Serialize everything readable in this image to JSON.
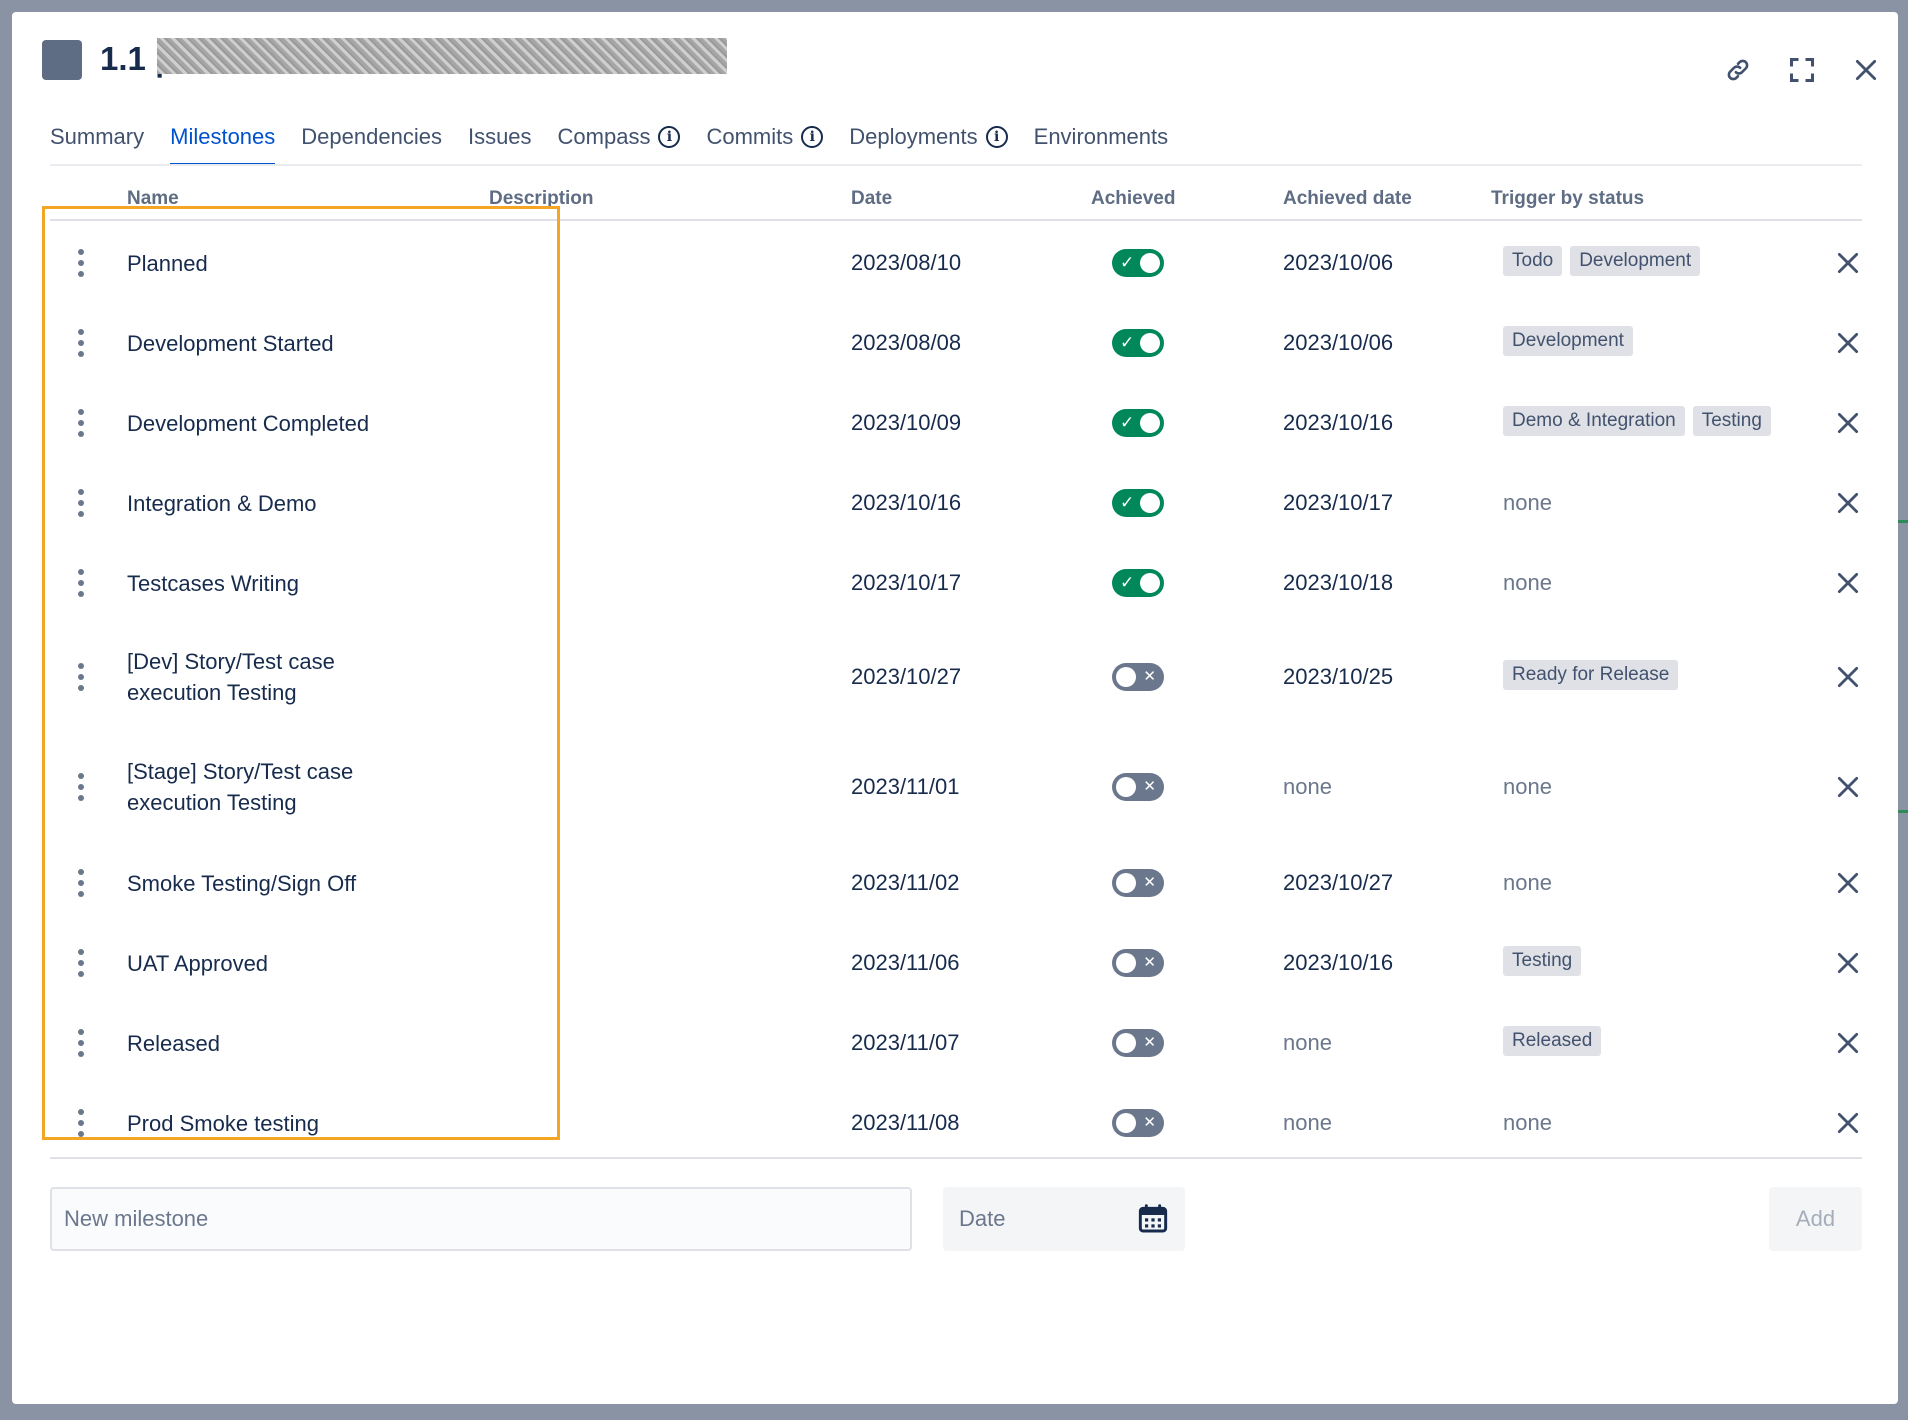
{
  "dialog": {
    "title_prefix": "1.1 |"
  },
  "tabs": [
    {
      "label": "Summary",
      "active": false,
      "info": false
    },
    {
      "label": "Milestones",
      "active": true,
      "info": false
    },
    {
      "label": "Dependencies",
      "active": false,
      "info": false
    },
    {
      "label": "Issues",
      "active": false,
      "info": false
    },
    {
      "label": "Compass",
      "active": false,
      "info": true
    },
    {
      "label": "Commits",
      "active": false,
      "info": true
    },
    {
      "label": "Deployments",
      "active": false,
      "info": true
    },
    {
      "label": "Environments",
      "active": false,
      "info": false
    }
  ],
  "info_glyph": "i",
  "table": {
    "headers": {
      "name": "Name",
      "description": "Description",
      "date": "Date",
      "achieved": "Achieved",
      "achieved_date": "Achieved date",
      "trigger": "Trigger by status"
    },
    "rows": [
      {
        "name": "Planned",
        "date": "2023/08/10",
        "achieved": true,
        "achieved_date": "2023/10/06",
        "trigger": [
          "Todo",
          "Development"
        ]
      },
      {
        "name": "Development Started",
        "date": "2023/08/08",
        "achieved": true,
        "achieved_date": "2023/10/06",
        "trigger": [
          "Development"
        ]
      },
      {
        "name": "Development Completed",
        "date": "2023/10/09",
        "achieved": true,
        "achieved_date": "2023/10/16",
        "trigger": [
          "Demo & Integration",
          "Testing"
        ]
      },
      {
        "name": "Integration & Demo",
        "date": "2023/10/16",
        "achieved": true,
        "achieved_date": "2023/10/17",
        "trigger": []
      },
      {
        "name": "Testcases Writing",
        "date": "2023/10/17",
        "achieved": true,
        "achieved_date": "2023/10/18",
        "trigger": []
      },
      {
        "name": "[Dev] Story/Test case execution Testing",
        "date": "2023/10/27",
        "achieved": false,
        "achieved_date": "2023/10/25",
        "trigger": [
          "Ready for Release"
        ]
      },
      {
        "name": "[Stage] Story/Test case execution Testing",
        "date": "2023/11/01",
        "achieved": false,
        "achieved_date": "",
        "trigger": []
      },
      {
        "name": "Smoke Testing/Sign Off",
        "date": "2023/11/02",
        "achieved": false,
        "achieved_date": "2023/10/27",
        "trigger": []
      },
      {
        "name": "UAT Approved",
        "date": "2023/11/06",
        "achieved": false,
        "achieved_date": "2023/10/16",
        "trigger": [
          "Testing"
        ]
      },
      {
        "name": "Released",
        "date": "2023/11/07",
        "achieved": false,
        "achieved_date": "",
        "trigger": [
          "Released"
        ]
      },
      {
        "name": "Prod Smoke testing",
        "date": "2023/11/08",
        "achieved": false,
        "achieved_date": "",
        "trigger": []
      }
    ],
    "empty_text": "none",
    "toggle_on_glyph": "✓",
    "toggle_off_glyph": "✕"
  },
  "form": {
    "milestone_placeholder": "New milestone",
    "date_placeholder": "Date",
    "add_label": "Add"
  },
  "icons": {
    "header": [
      "link-icon",
      "expand-icon",
      "close-icon"
    ],
    "row_handle": "drag-handle-icon",
    "row_delete": "delete-icon",
    "date_picker": "calendar-icon"
  },
  "colors": {
    "accent": "#0052cc",
    "toggle_on": "#00875a",
    "toggle_off": "#6b778c",
    "highlight": "#f5a524",
    "tag_bg": "#dfe1e6"
  }
}
